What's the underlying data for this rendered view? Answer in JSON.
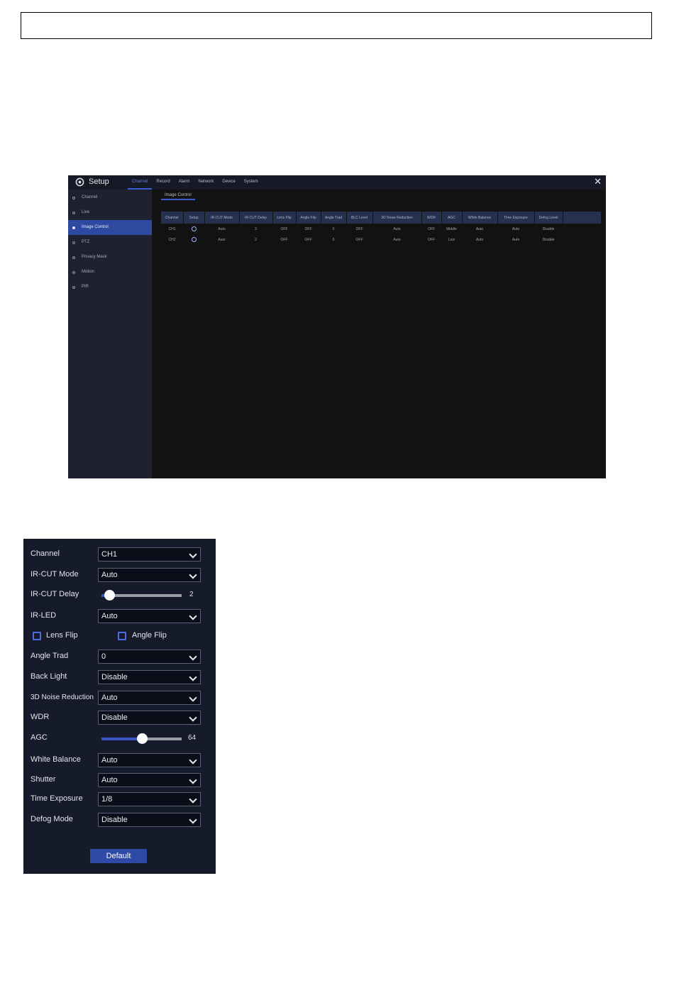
{
  "setup_window": {
    "title": "Setup",
    "tabs": [
      "Channel",
      "Record",
      "Alarm",
      "Network",
      "Device",
      "System"
    ],
    "active_tab": "Channel",
    "close_icon": "close-icon",
    "sidebar": [
      "Channel",
      "Live",
      "Image Control",
      "PTZ",
      "Privacy Mask",
      "Motion",
      "PIR"
    ],
    "active_sidebar": "Image Control",
    "subtab": "Image Control",
    "table": {
      "headers": [
        "Channel",
        "Setup",
        "IR-CUT Mode",
        "IR-CUT Delay",
        "Lens Flip",
        "Angle Flip",
        "Angle Trad",
        "BLC Level",
        "3D Noise Reduction",
        "WDR",
        "AGC",
        "White Balance",
        "Time Exposure",
        "Defog Level"
      ],
      "rows": [
        [
          "CH1",
          "",
          "Auto",
          "2",
          "OFF",
          "OFF",
          "0",
          "OFF",
          "Auto",
          "OFF",
          "Middle",
          "Auto",
          "Auto",
          "Disable"
        ],
        [
          "CH2",
          "",
          "Auto",
          "2",
          "OFF",
          "OFF",
          "0",
          "OFF",
          "Auto",
          "OFF",
          "Low",
          "Auto",
          "Auto",
          "Disable"
        ]
      ]
    }
  },
  "image_control_panel": {
    "channel": {
      "label": "Channel",
      "value": "CH1"
    },
    "ir_cut_mode": {
      "label": "IR-CUT Mode",
      "value": "Auto"
    },
    "ir_cut_delay": {
      "label": "IR-CUT Delay",
      "value": "2",
      "fraction": 0.1
    },
    "ir_led": {
      "label": "IR-LED",
      "value": "Auto"
    },
    "lens_flip": {
      "label": "Lens Flip",
      "checked": false
    },
    "angle_flip": {
      "label": "Angle Flip",
      "checked": false
    },
    "angle_trad": {
      "label": "Angle Trad",
      "value": "0"
    },
    "back_light": {
      "label": "Back Light",
      "value": "Disable"
    },
    "noise_reduction": {
      "label": "3D Noise Reduction",
      "value": "Auto"
    },
    "wdr": {
      "label": "WDR",
      "value": "Disable"
    },
    "agc": {
      "label": "AGC",
      "value": "64",
      "fraction": 0.5
    },
    "white_balance": {
      "label": "White Balance",
      "value": "Auto"
    },
    "shutter": {
      "label": "Shutter",
      "value": "Auto"
    },
    "time_exposure": {
      "label": "Time Exposure",
      "value": "1/8"
    },
    "defog_mode": {
      "label": "Defog Mode",
      "value": "Disable"
    },
    "default_button": "Default"
  },
  "colors": {
    "accent": "#3b5bd1",
    "panel_bg": "#161b2c",
    "window_bg": "#121212"
  }
}
